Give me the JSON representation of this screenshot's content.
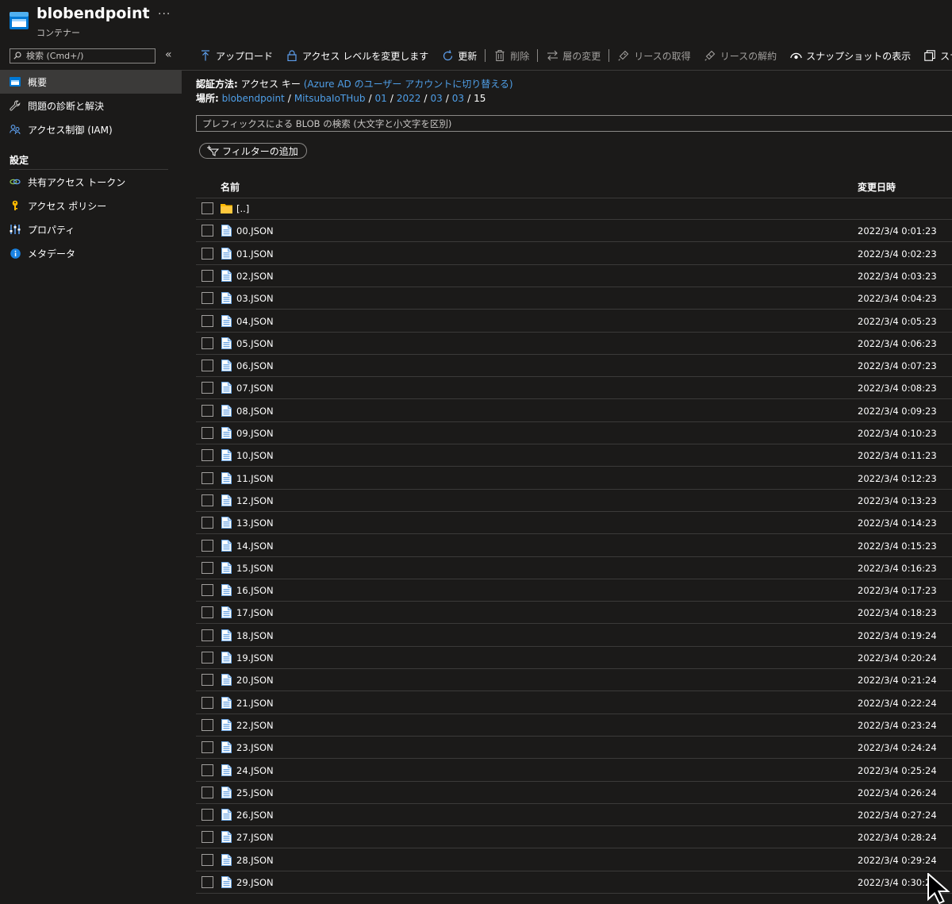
{
  "header": {
    "title": "blobendpoint",
    "subtitle": "コンテナー",
    "more": "···",
    "icon": "storage-container-icon"
  },
  "sidebar": {
    "search_placeholder": "検索 (Cmd+/)",
    "collapse": "«",
    "items": [
      {
        "label": "概要",
        "icon": "container-icon",
        "active": true
      },
      {
        "label": "問題の診断と解決",
        "icon": "wrench-icon"
      },
      {
        "label": "アクセス制御 (IAM)",
        "icon": "people-icon"
      }
    ],
    "section_settings": "設定",
    "settings_items": [
      {
        "label": "共有アクセス トークン",
        "icon": "link-icon"
      },
      {
        "label": "アクセス ポリシー",
        "icon": "key-icon"
      },
      {
        "label": "プロパティ",
        "icon": "sliders-icon"
      },
      {
        "label": "メタデータ",
        "icon": "info-icon"
      }
    ]
  },
  "toolbar": {
    "upload": "アップロード",
    "change_access": "アクセス レベルを変更します",
    "refresh": "更新",
    "delete": "削除",
    "change_tier": "層の変更",
    "acquire_lease": "リースの取得",
    "break_lease": "リースの解約",
    "view_snapshots": "スナップショットの表示",
    "create_snapshot": "スナ"
  },
  "auth": {
    "label": "認証方法:",
    "value": "アクセス キー",
    "link": "(Azure AD のユーザー アカウントに切り替える)"
  },
  "location": {
    "label": "場所:",
    "crumbs": [
      "blobendpoint",
      "MitsubaIoTHub",
      "01",
      "2022",
      "03",
      "03"
    ],
    "separator": "/",
    "current": "15"
  },
  "blob_search": {
    "placeholder": "プレフィックスによる BLOB の検索 (大文字と小文字を区別)"
  },
  "filter": {
    "label": "フィルターの追加"
  },
  "grid": {
    "col_name": "名前",
    "col_modified": "変更日時",
    "parent": "[..]",
    "rows": [
      {
        "name": "00.JSON",
        "modified": "2022/3/4 0:01:23"
      },
      {
        "name": "01.JSON",
        "modified": "2022/3/4 0:02:23"
      },
      {
        "name": "02.JSON",
        "modified": "2022/3/4 0:03:23"
      },
      {
        "name": "03.JSON",
        "modified": "2022/3/4 0:04:23"
      },
      {
        "name": "04.JSON",
        "modified": "2022/3/4 0:05:23"
      },
      {
        "name": "05.JSON",
        "modified": "2022/3/4 0:06:23"
      },
      {
        "name": "06.JSON",
        "modified": "2022/3/4 0:07:23"
      },
      {
        "name": "07.JSON",
        "modified": "2022/3/4 0:08:23"
      },
      {
        "name": "08.JSON",
        "modified": "2022/3/4 0:09:23"
      },
      {
        "name": "09.JSON",
        "modified": "2022/3/4 0:10:23"
      },
      {
        "name": "10.JSON",
        "modified": "2022/3/4 0:11:23"
      },
      {
        "name": "11.JSON",
        "modified": "2022/3/4 0:12:23"
      },
      {
        "name": "12.JSON",
        "modified": "2022/3/4 0:13:23"
      },
      {
        "name": "13.JSON",
        "modified": "2022/3/4 0:14:23"
      },
      {
        "name": "14.JSON",
        "modified": "2022/3/4 0:15:23"
      },
      {
        "name": "15.JSON",
        "modified": "2022/3/4 0:16:23"
      },
      {
        "name": "16.JSON",
        "modified": "2022/3/4 0:17:23"
      },
      {
        "name": "17.JSON",
        "modified": "2022/3/4 0:18:23"
      },
      {
        "name": "18.JSON",
        "modified": "2022/3/4 0:19:24"
      },
      {
        "name": "19.JSON",
        "modified": "2022/3/4 0:20:24"
      },
      {
        "name": "20.JSON",
        "modified": "2022/3/4 0:21:24"
      },
      {
        "name": "21.JSON",
        "modified": "2022/3/4 0:22:24"
      },
      {
        "name": "22.JSON",
        "modified": "2022/3/4 0:23:24"
      },
      {
        "name": "23.JSON",
        "modified": "2022/3/4 0:24:24"
      },
      {
        "name": "24.JSON",
        "modified": "2022/3/4 0:25:24"
      },
      {
        "name": "25.JSON",
        "modified": "2022/3/4 0:26:24"
      },
      {
        "name": "26.JSON",
        "modified": "2022/3/4 0:27:24"
      },
      {
        "name": "27.JSON",
        "modified": "2022/3/4 0:28:24"
      },
      {
        "name": "28.JSON",
        "modified": "2022/3/4 0:29:24"
      },
      {
        "name": "29.JSON",
        "modified": "2022/3/4 0:30:24"
      }
    ]
  },
  "colors": {
    "background": "#1b1a19",
    "active_nav": "#3b3a39",
    "link": "#4f9fe8",
    "border": "#3b3a39",
    "folder": "#ffb900",
    "file_icon": "#6ca6e4"
  }
}
